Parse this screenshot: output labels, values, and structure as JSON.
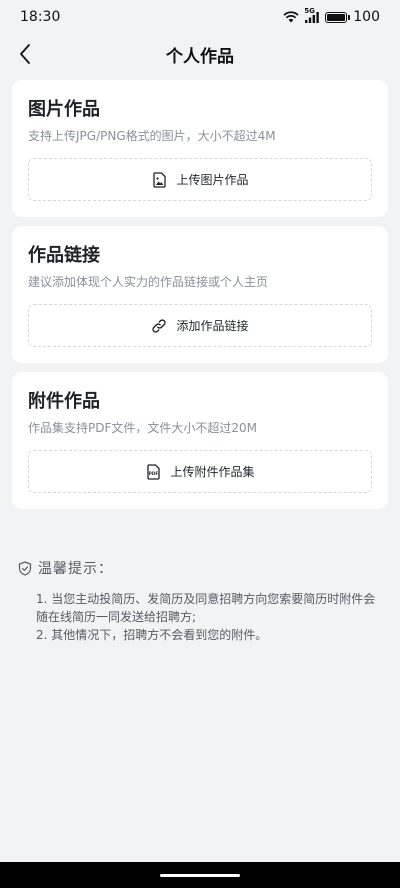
{
  "status": {
    "time": "18:30",
    "network": "5G",
    "battery": "100"
  },
  "nav": {
    "title": "个人作品"
  },
  "sections": [
    {
      "title": "图片作品",
      "subtitle": "支持上传JPG/PNG格式的图片，大小不超过4M",
      "action": "上传图片作品",
      "icon": "image-icon"
    },
    {
      "title": "作品链接",
      "subtitle": "建议添加体现个人实力的作品链接或个人主页",
      "action": "添加作品链接",
      "icon": "link-icon"
    },
    {
      "title": "附件作品",
      "subtitle": "作品集支持PDF文件，文件大小不超过20M",
      "action": "上传附件作品集",
      "icon": "pdf-icon",
      "icon_text": "PDF"
    }
  ],
  "tips": {
    "title": "温馨提示：",
    "items": [
      "1. 当您主动投简历、发简历及同意招聘方向您索要简历时附件会随在线简历一同发送给招聘方;",
      "2. 其他情况下，招聘方不会看到您的附件。"
    ]
  }
}
